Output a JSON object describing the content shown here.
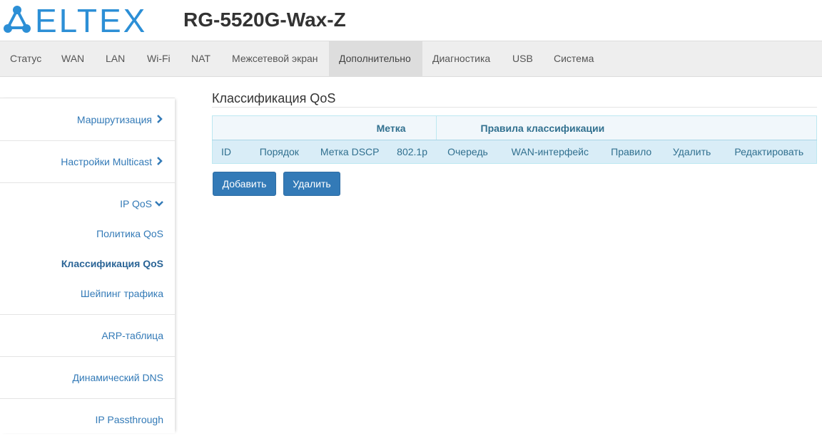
{
  "header": {
    "logo_text": "ELTEX",
    "model": "RG-5520G-Wax-Z",
    "brand_color": "#2c8fd6"
  },
  "topnav": {
    "tabs": [
      {
        "label": "Статус"
      },
      {
        "label": "WAN"
      },
      {
        "label": "LAN"
      },
      {
        "label": "Wi-Fi"
      },
      {
        "label": "NAT"
      },
      {
        "label": "Межсетевой экран"
      },
      {
        "label": "Дополнительно",
        "active": true
      },
      {
        "label": "Диагностика"
      },
      {
        "label": "USB"
      },
      {
        "label": "Система"
      }
    ]
  },
  "sidebar": {
    "items": [
      {
        "label": "Маршрутизация",
        "icon": "chevron-right-icon"
      },
      {
        "label": "Настройки Multicast",
        "icon": "chevron-right-icon"
      },
      {
        "label": "IP QoS",
        "icon": "chevron-down-icon"
      },
      {
        "label": "ARP-таблица"
      },
      {
        "label": "Динамический DNS"
      },
      {
        "label": "IP Passthrough"
      }
    ],
    "qos_sub": [
      {
        "label": "Политика QoS"
      },
      {
        "label": "Классификация QoS",
        "active": true
      },
      {
        "label": "Шейпинг трафика"
      }
    ]
  },
  "main": {
    "title": "Классификация QoS",
    "table": {
      "group_headers": [
        "Метка",
        "Правила классификации"
      ],
      "columns": [
        "ID",
        "Порядок",
        "Метка DSCP",
        "802.1p",
        "Очередь",
        "WAN-интерфейс",
        "Правило",
        "Удалить",
        "Редактировать"
      ]
    },
    "buttons": {
      "add": "Добавить",
      "delete": "Удалить"
    }
  }
}
